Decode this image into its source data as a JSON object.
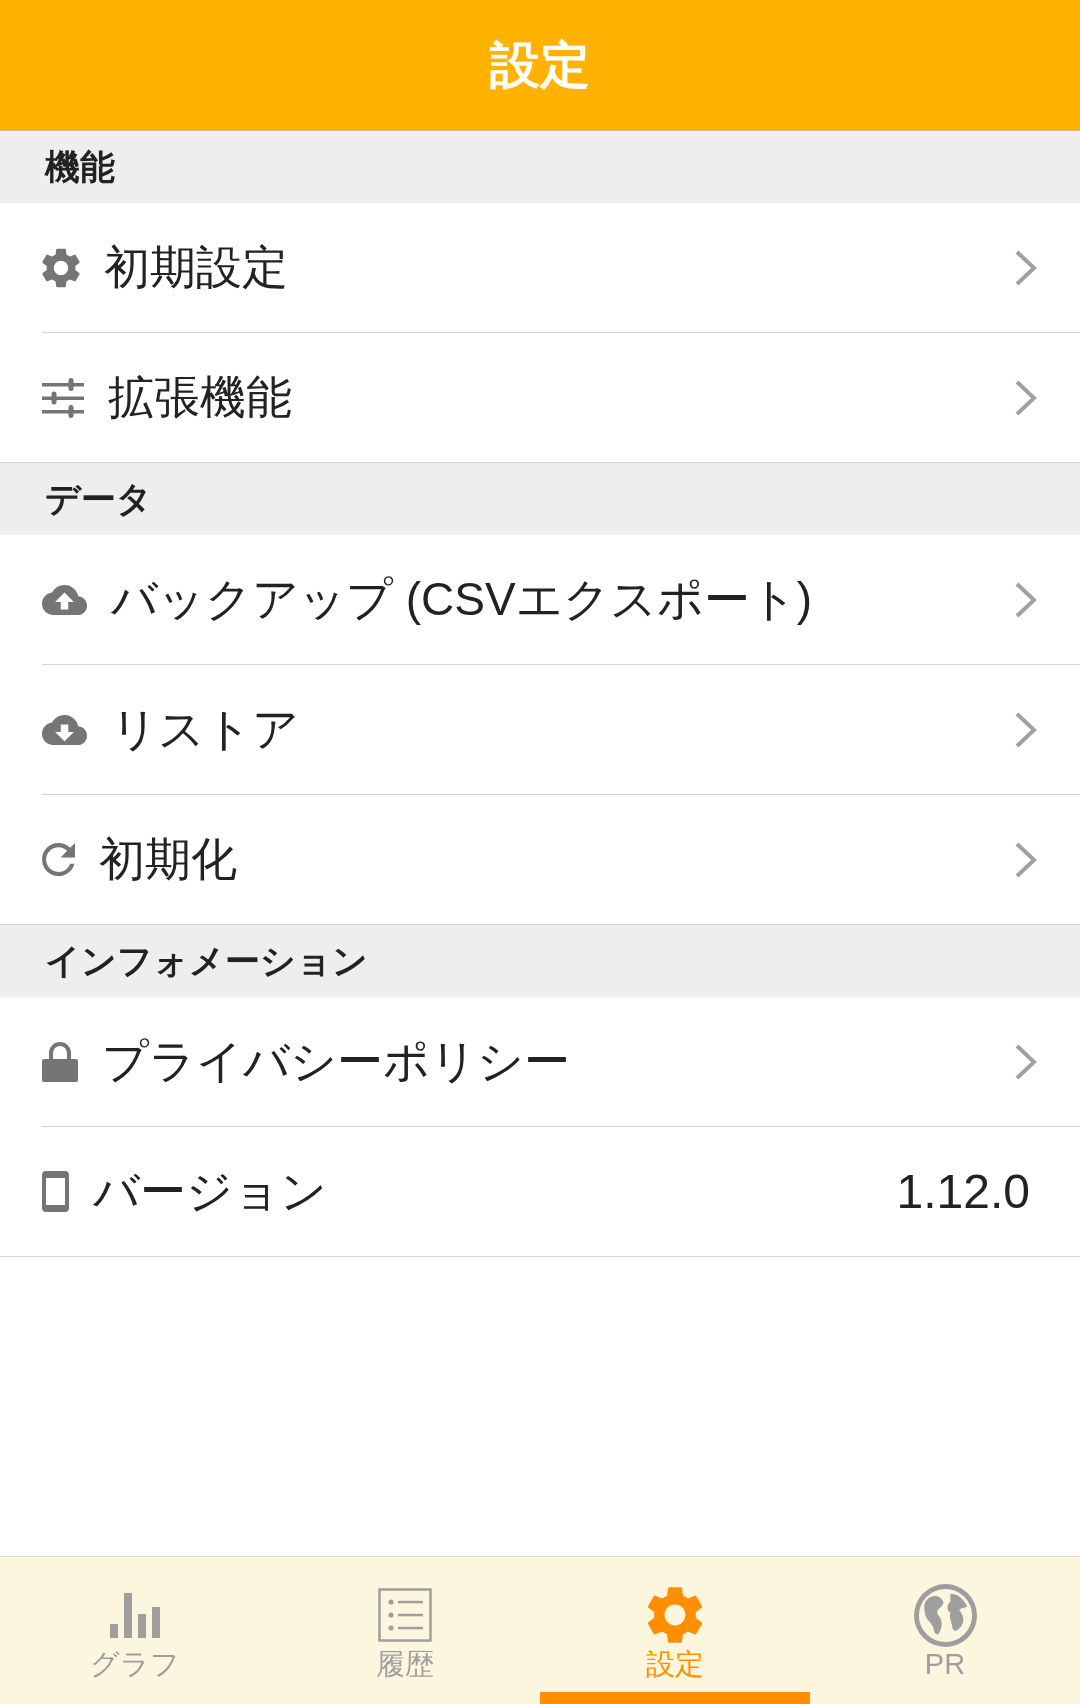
{
  "app_bar": {
    "title": "設定"
  },
  "sections": [
    {
      "title": "機能",
      "items": [
        {
          "kind": "link",
          "label": "初期設定"
        },
        {
          "kind": "link",
          "label": "拡張機能"
        }
      ]
    },
    {
      "title": "データ",
      "items": [
        {
          "kind": "link",
          "label": "バックアップ (CSVエクスポート)"
        },
        {
          "kind": "link",
          "label": "リストア"
        },
        {
          "kind": "link",
          "label": "初期化"
        }
      ]
    },
    {
      "title": "インフォメーション",
      "items": [
        {
          "kind": "link",
          "label": "プライバシーポリシー"
        },
        {
          "kind": "value",
          "label": "バージョン",
          "value": "1.12.0"
        }
      ]
    }
  ],
  "tab_bar": {
    "tabs": [
      {
        "label": "グラフ",
        "selected": false
      },
      {
        "label": "履歴",
        "selected": false
      },
      {
        "label": "設定",
        "selected": true
      },
      {
        "label": "PR",
        "selected": false
      }
    ]
  }
}
